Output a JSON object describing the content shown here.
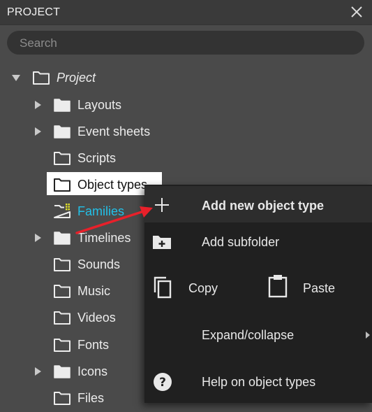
{
  "panel": {
    "title": "PROJECT",
    "search_placeholder": "Search"
  },
  "tree": {
    "root": "Project",
    "items": [
      {
        "label": "Layouts",
        "expandable": true,
        "filled": true
      },
      {
        "label": "Event sheets",
        "expandable": true,
        "filled": true
      },
      {
        "label": "Scripts",
        "expandable": false,
        "filled": false
      },
      {
        "label": "Object types",
        "expandable": false,
        "filled": false,
        "selected": true
      },
      {
        "label": "Families",
        "expandable": false,
        "filled": false
      },
      {
        "label": "Timelines",
        "expandable": true,
        "filled": true
      },
      {
        "label": "Sounds",
        "expandable": false,
        "filled": false
      },
      {
        "label": "Music",
        "expandable": false,
        "filled": false
      },
      {
        "label": "Videos",
        "expandable": false,
        "filled": false
      },
      {
        "label": "Fonts",
        "expandable": false,
        "filled": false
      },
      {
        "label": "Icons",
        "expandable": true,
        "filled": true
      },
      {
        "label": "Files",
        "expandable": false,
        "filled": false
      }
    ]
  },
  "context_menu": {
    "add_new": "Add new object type",
    "add_subfolder": "Add subfolder",
    "copy": "Copy",
    "paste": "Paste",
    "expand_collapse": "Expand/collapse",
    "help": "Help on object types"
  },
  "colors": {
    "panel_bg": "#4a4a4a",
    "menu_bg": "#202020",
    "families_accent": "#22c0e8",
    "annotation_arrow": "#e8202a"
  }
}
